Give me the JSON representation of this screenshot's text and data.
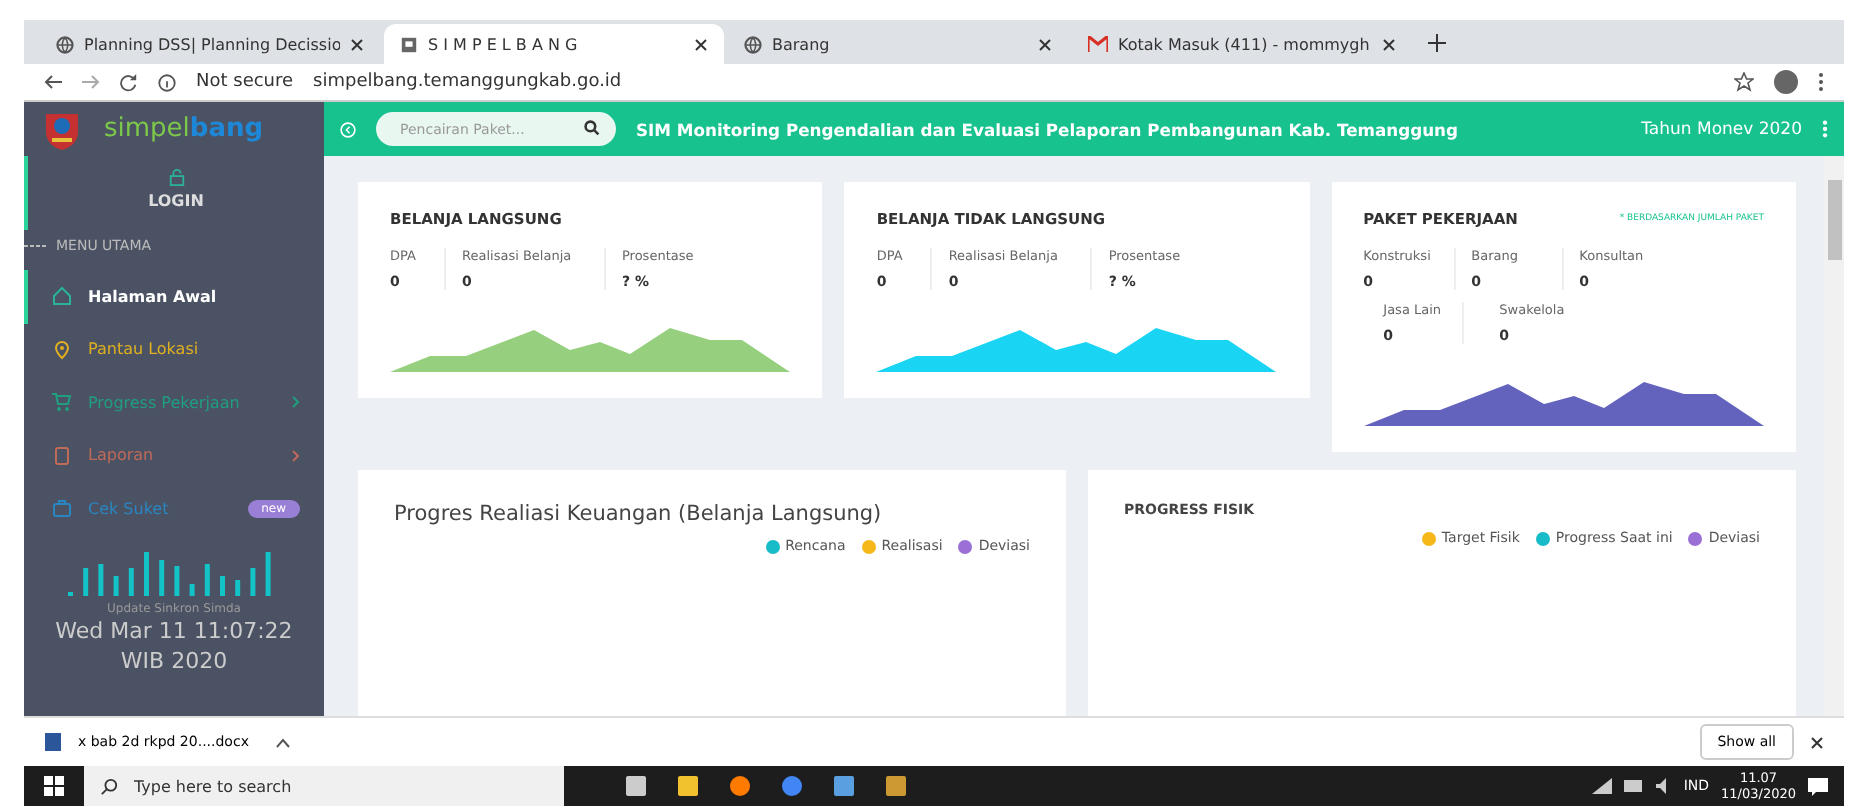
{
  "browser": {
    "tabs": [
      {
        "title": "Planning DSS| Planning Decissio",
        "selected": false,
        "kind": "globe"
      },
      {
        "title": "S I M P E L B A N G",
        "selected": true,
        "kind": "site"
      },
      {
        "title": "Barang",
        "selected": false,
        "kind": "globe"
      },
      {
        "title": "Kotak Masuk (411) - mommygh",
        "selected": false,
        "kind": "mail"
      }
    ],
    "security": "Not secure",
    "url": "simpelbang.temanggungkab.go.id"
  },
  "sidebar": {
    "brand": [
      "simpel",
      "bang"
    ],
    "login": "LOGIN",
    "section": "MENU UTAMA",
    "items": [
      {
        "label": "Halaman Awal",
        "selected": true,
        "color": "#2bb39a",
        "kind": "home",
        "chevron": false
      },
      {
        "label": "Pantau Lokasi",
        "selected": false,
        "color": "#e0b020",
        "kind": "pin",
        "chevron": false
      },
      {
        "label": "Progress Pekerjaan",
        "selected": false,
        "color": "#1f9e80",
        "kind": "cart",
        "chevron": true
      },
      {
        "label": "Laporan",
        "selected": false,
        "color": "#c06a5a",
        "kind": "doc",
        "chevron": true
      },
      {
        "label": "Cek Suket",
        "selected": false,
        "color": "#2a86c0",
        "kind": "bag",
        "chevron": false,
        "badge": "new"
      }
    ],
    "sync_label": "Update Sinkron Simda",
    "sync_time": "Wed Mar 11 11:07:22 WIB 2020"
  },
  "header": {
    "search": {
      "placeholder": "Pencairan Paket..."
    },
    "title": "SIM Monitoring Pengendalian dan Evaluasi Pelaporan Pembangunan Kab. Temanggung",
    "year": "Tahun Monev 2020"
  },
  "cards": [
    {
      "title": "BELANJA LANGSUNG",
      "color": "#96d07e",
      "metrics": [
        {
          "label": "DPA",
          "value": "0"
        },
        {
          "label": "Realisasi Belanja",
          "value": "0"
        },
        {
          "label": "Prosentase",
          "value": "? %"
        }
      ]
    },
    {
      "title": "BELANJA TIDAK LANGSUNG",
      "color": "#1ad4f4",
      "metrics": [
        {
          "label": "DPA",
          "value": "0"
        },
        {
          "label": "Realisasi Belanja",
          "value": "0"
        },
        {
          "label": "Prosentase",
          "value": "? %"
        }
      ]
    },
    {
      "title": "PAKET PEKERJAAN",
      "note": "* BERDASARKAN JUMLAH PAKET",
      "color": "#6363be",
      "metrics": [
        {
          "label": "Konstruksi",
          "value": "0"
        },
        {
          "label": "Barang",
          "value": "0"
        },
        {
          "label": "Konsultan",
          "value": "0"
        },
        {
          "label": "Jasa Lain",
          "value": "0"
        },
        {
          "label": "Swakelola",
          "value": "0"
        }
      ]
    }
  ],
  "panels": [
    {
      "title": "Progres Realiasi Keuangan (Belanja Langsung)",
      "kind": "large",
      "legend": [
        {
          "name": "Rencana",
          "color": "#17bcc8"
        },
        {
          "name": "Realisasi",
          "color": "#f6b818"
        },
        {
          "name": "Deviasi",
          "color": "#9a6fd6"
        }
      ]
    },
    {
      "title": "PROGRESS FISIK",
      "kind": "small",
      "legend": [
        {
          "name": "Target Fisik",
          "color": "#f6b818"
        },
        {
          "name": "Progress Saat ini",
          "color": "#17bcc8"
        },
        {
          "name": "Deviasi",
          "color": "#9a6fd6"
        }
      ]
    }
  ],
  "downloads": {
    "file": "x bab 2d rkpd 20....docx",
    "show_all": "Show all"
  },
  "taskbar": {
    "search": "Type here to search",
    "language": "IND",
    "time": "11.07",
    "date": "11/03/2020"
  }
}
